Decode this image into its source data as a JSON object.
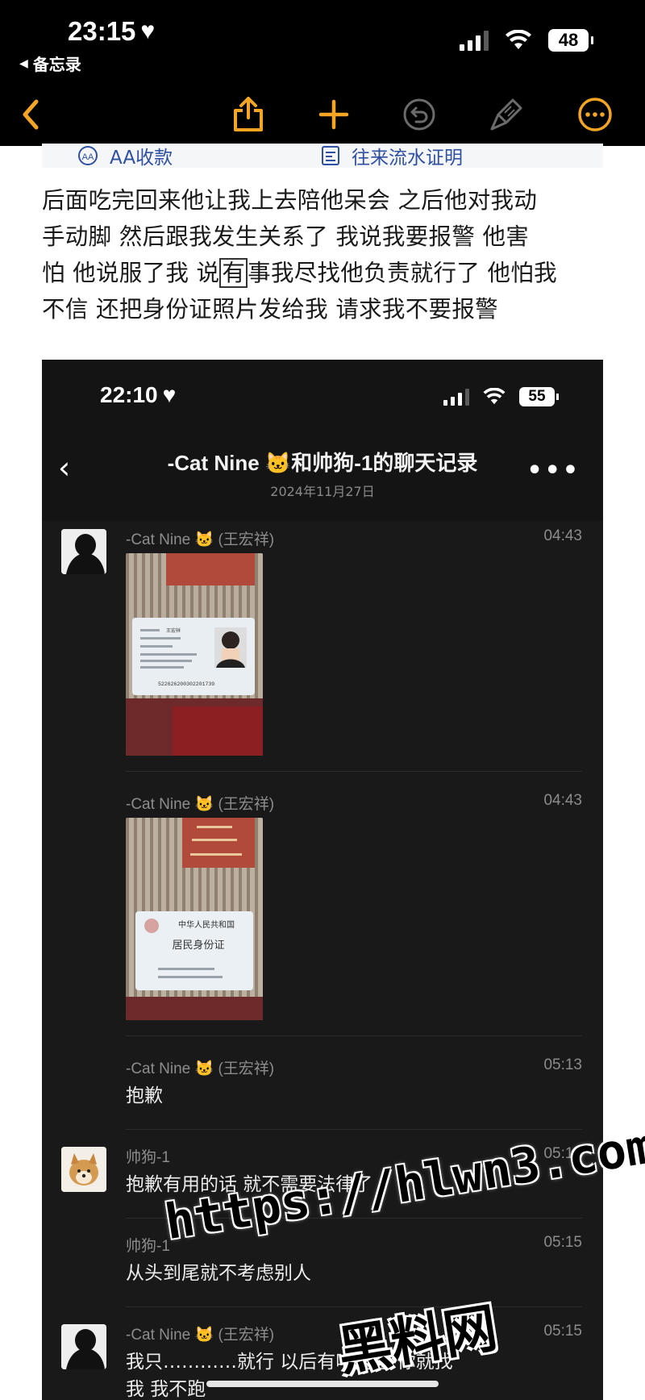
{
  "status_bar": {
    "time": "23:15",
    "back_app": "备忘录",
    "battery": "48"
  },
  "toolbar": {
    "icons": [
      "back-chevron-icon",
      "share-icon",
      "plus-icon",
      "undo-icon",
      "markup-icon",
      "more-icon"
    ],
    "accent": "#f5a524"
  },
  "faded_row": {
    "left_label": "AA收款",
    "right_label": "往来流水证明"
  },
  "note": {
    "line1": "后面吃完回来他让我上去陪他呆会 之后他对我动",
    "line2": "手动脚 然后跟我发生关系了 我说我要报警 他害",
    "line3_pre": "怕 他说服了我 说",
    "line3_boxed": "有",
    "line3_post": "事我尽找他负责就行了 他怕我",
    "line4": "不信 还把身份证照片发给我 请求我不要报警"
  },
  "chat": {
    "status_time": "22:10",
    "battery": "55",
    "title": "-Cat Nine 🐱和帅狗-1的聊天记录",
    "date": "2024年11月27日",
    "messages": [
      {
        "sender": "-Cat Nine 🐱 (王宏祥)",
        "time": "04:43",
        "type": "image"
      },
      {
        "sender": "-Cat Nine 🐱 (王宏祥)",
        "time": "04:43",
        "type": "image"
      },
      {
        "sender": "-Cat Nine 🐱 (王宏祥)",
        "time": "05:13",
        "text": "抱歉"
      },
      {
        "sender": "帅狗-1",
        "time": "05:14",
        "text": "抱歉有用的话 就不需要法律了"
      },
      {
        "sender": "帅狗-1",
        "time": "05:15",
        "text": "从头到尾就不考虑别人"
      },
      {
        "sender": "-Cat Nine 🐱 (王宏祥)",
        "time": "05:15",
        "text": "我只…………就行 以后有啥问题 你就找",
        "text2": "我 我不跑"
      }
    ],
    "id_card_1": {
      "name": "王宏祥",
      "id_number": "522626200302201739"
    },
    "id_card_2": {
      "header": "中华人民共和国",
      "title": "居民身份证"
    }
  },
  "watermark": {
    "url": "https://hlwn3.com",
    "site": "黑料网"
  }
}
